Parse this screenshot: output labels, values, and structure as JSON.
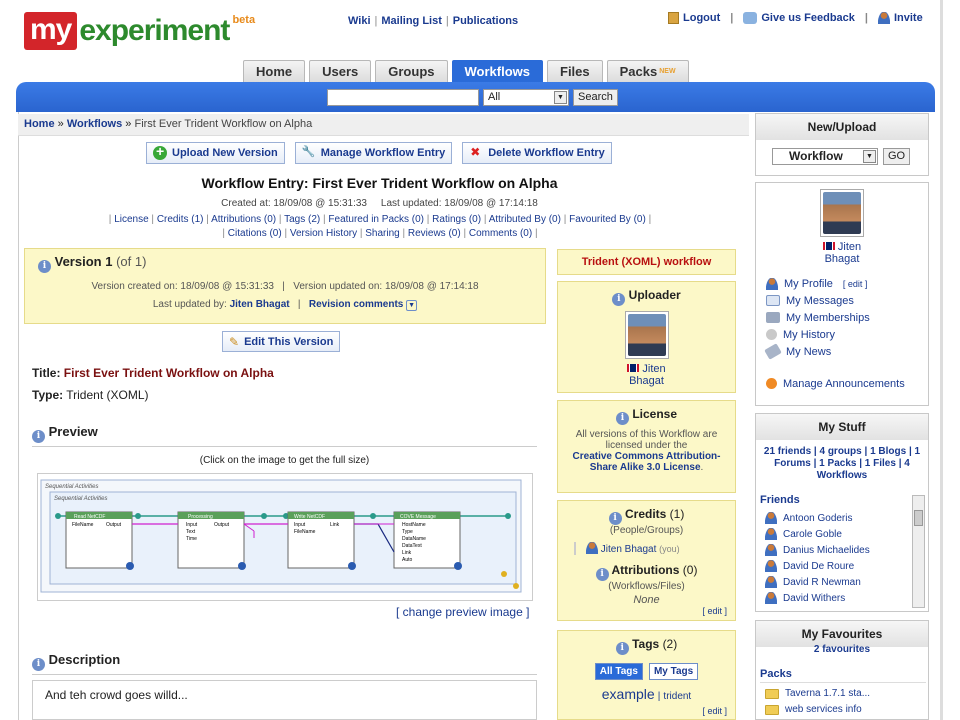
{
  "logo": {
    "my": "my",
    "experiment": "experiment",
    "beta": "beta"
  },
  "top_links": [
    "Wiki",
    "Mailing List",
    "Publications"
  ],
  "user_links": {
    "logout": "Logout",
    "feedback": "Give us Feedback",
    "invite": "Invite"
  },
  "tabs": [
    {
      "label": "Home",
      "active": false
    },
    {
      "label": "Users",
      "active": false
    },
    {
      "label": "Groups",
      "active": false
    },
    {
      "label": "Workflows",
      "active": true
    },
    {
      "label": "Files",
      "active": false
    },
    {
      "label": "Packs",
      "active": false,
      "badge": "NEW"
    }
  ],
  "search": {
    "value": "",
    "scope": "All",
    "button": "Search"
  },
  "breadcrumb": {
    "home": "Home",
    "sep": "»",
    "workflows": "Workflows",
    "current": "First Ever Trident Workflow on Alpha"
  },
  "actions": {
    "upload": "Upload New Version",
    "manage": "Manage Workflow Entry",
    "delete": "Delete Workflow Entry"
  },
  "entry": {
    "heading": "Workflow Entry: First Ever Trident Workflow on Alpha",
    "created_label": "Created at:",
    "created": "18/09/08 @ 15:31:33",
    "updated_label": "Last updated:",
    "updated": "18/09/08 @ 17:14:18"
  },
  "nav_links_row1": [
    "License",
    "Credits (1)",
    "Attributions (0)",
    "Tags (2)",
    "Featured in Packs (0)",
    "Ratings (0)",
    "Attributed By (0)",
    "Favourited By (0)"
  ],
  "nav_links_row2": [
    "Citations (0)",
    "Version History",
    "Sharing",
    "Reviews (0)",
    "Comments (0)"
  ],
  "version": {
    "title": "Version 1",
    "of": "(of 1)",
    "created_label": "Version created on:",
    "created": "18/09/08 @ 15:31:33",
    "updated_label": "Version updated on:",
    "updated": "18/09/08 @ 17:14:18",
    "last_by_label": "Last updated by:",
    "last_by": "Jiten Bhagat",
    "revision": "Revision comments",
    "edit_button": "Edit This Version"
  },
  "workflow": {
    "title_label": "Title:",
    "title": "First Ever Trident Workflow on Alpha",
    "type_label": "Type:",
    "type": "Trident (XOML)"
  },
  "preview": {
    "heading": "Preview",
    "hint": "(Click on the image to get the full size)",
    "change": "[ change preview image ]",
    "outer_label": "Sequential Activities",
    "inner_label": "Sequential Activities",
    "nodes": [
      {
        "name": "Read NetCDF",
        "ports": [
          "FileName",
          "Output"
        ]
      },
      {
        "name": "Processing",
        "ports": [
          "Input",
          "Output",
          "Text",
          "Time"
        ]
      },
      {
        "name": "Write NetCDF",
        "ports": [
          "Input",
          "Link",
          "FileName"
        ]
      },
      {
        "name": "COVE Message",
        "ports": [
          "HostName",
          "Type",
          "DataName",
          "DataText",
          "Link",
          "Auto"
        ]
      }
    ]
  },
  "description": {
    "heading": "Description",
    "text": "And teh crowd goes willd..."
  },
  "middle": {
    "wf_type": "Trident (XOML) workflow",
    "uploader_heading": "Uploader",
    "uploader_first": "Jiten",
    "uploader_last": "Bhagat",
    "license_heading": "License",
    "license_text": "All versions of this Workflow are licensed under the",
    "license_name": "Creative Commons Attribution-Share Alike 3.0 License",
    "credits_heading": "Credits",
    "credits_count": "(1)",
    "credits_sub": "(People/Groups)",
    "credit_person": "Jiten Bhagat",
    "credit_you": "(you)",
    "attr_heading": "Attributions",
    "attr_count": "(0)",
    "attr_sub": "(Workflows/Files)",
    "attr_none": "None",
    "edit": "[ edit ]",
    "tags_heading": "Tags",
    "tags_count": "(2)",
    "tag_tab_all": "All Tags",
    "tag_tab_my": "My Tags",
    "tag_big": "example",
    "tag_sep": "|",
    "tag_small": "trident"
  },
  "sidebar": {
    "newupload_heading": "New/Upload",
    "newupload_select": "Workflow",
    "go": "GO",
    "profile_first": "Jiten",
    "profile_last": "Bhagat",
    "menu": [
      "My Profile",
      "My Messages",
      "My Memberships",
      "My History",
      "My News",
      "Manage Announcements"
    ],
    "profile_edit": "[ edit ]",
    "mystuff_heading": "My Stuff",
    "mystuff_summary": "21 friends | 4 groups | 1 Blogs | 1 Forums | 1 Packs | 1 Files | 4 Workflows",
    "friends_heading": "Friends",
    "friends": [
      "Antoon Goderis",
      "Carole Goble",
      "Danius Michaelides",
      "David De Roure",
      "David R Newman",
      "David Withers"
    ],
    "myfav_heading": "My Favourites",
    "myfav_sub": "2 favourites",
    "packs_heading": "Packs",
    "packs": [
      "Taverna 1.7.1 sta...",
      "web services info"
    ]
  },
  "colors": {
    "brand_red": "#d3252a",
    "brand_green": "#2d8a2d",
    "tab_active": "#2a6bd8",
    "yellow_panel": "#fcf8c8",
    "link": "#1a3a8f"
  }
}
